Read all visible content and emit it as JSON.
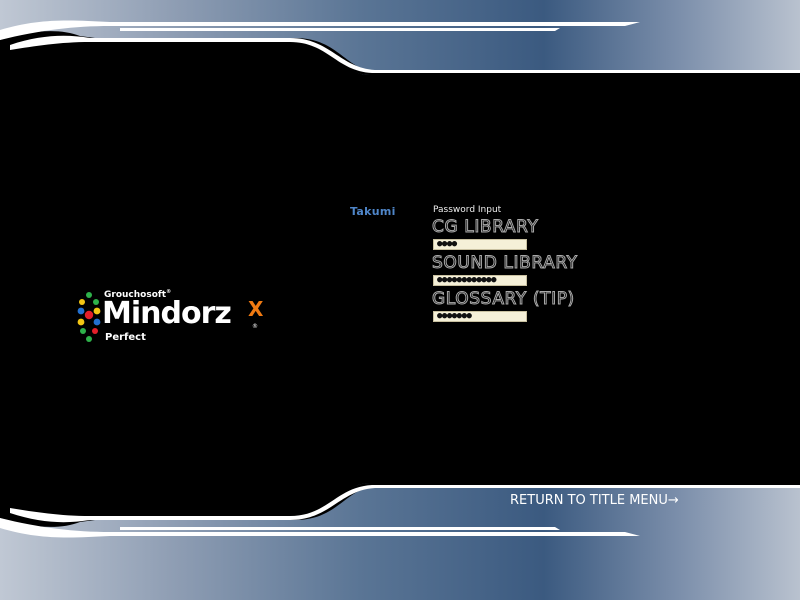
{
  "logo": {
    "brand": "Grouchosoft",
    "brand_mark": "®",
    "name": "Mindorz",
    "name_suffix": "X",
    "reg_mark": "®",
    "edition": "Perfect"
  },
  "user": {
    "name": "Takumi"
  },
  "password_panel": {
    "heading": "Password Input",
    "entries": [
      {
        "title": "CG LIBRARY",
        "masked_value": "●●●●"
      },
      {
        "title": "SOUND LIBRARY",
        "masked_value": "●●●●●●●●●●●●"
      },
      {
        "title": "GLOSSARY (TIP)",
        "masked_value": "●●●●●●●"
      }
    ]
  },
  "footer": {
    "return_label": "RETURN TO TITLE MENU→"
  },
  "colors": {
    "frame_light": "#b4bdcb",
    "frame_dark": "#3d5a7e",
    "accent_name": "#4f86c9",
    "accent_x": "#f07a12",
    "field_bg": "#f5f0d8"
  }
}
